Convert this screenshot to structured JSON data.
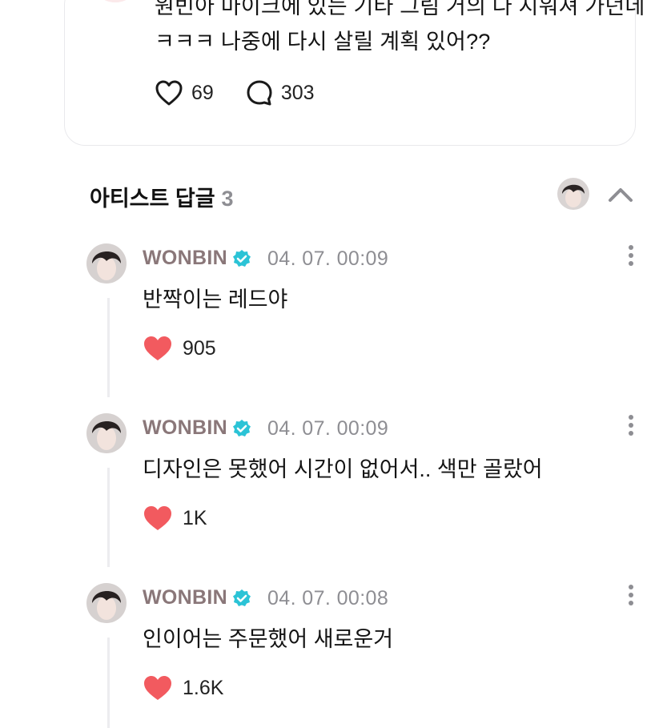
{
  "post": {
    "text_line1": "원빈아 마이크에 있는 기타 그림 거의 다 지워져 가던데",
    "text_line2": "ㅋㅋㅋ 나중에 다시 살릴 계획 있어??",
    "likes": "69",
    "comments": "303"
  },
  "artist_replies": {
    "title": "아티스트 답글",
    "count": "3"
  },
  "replies": [
    {
      "name": "WONBIN",
      "time": "04. 07. 00:09",
      "text": "반짝이는 레드야",
      "likes": "905"
    },
    {
      "name": "WONBIN",
      "time": "04. 07. 00:09",
      "text": "디자인은 못했어 시간이 없어서.. 색만 골랐어",
      "likes": "1K"
    },
    {
      "name": "WONBIN",
      "time": "04. 07. 00:08",
      "text": "인이어는 주문했어 새로운거",
      "likes": "1.6K"
    }
  ],
  "colors": {
    "like_heart": "#f25a5f",
    "verified_badge": "#2bc3d6",
    "artist_name": "#8a7779",
    "muted_text": "#8e8e93"
  },
  "icons": [
    "heart-outline-icon",
    "comment-bubble-icon",
    "chevron-up-icon",
    "verified-badge-icon",
    "more-vertical-icon",
    "heart-filled-icon"
  ]
}
